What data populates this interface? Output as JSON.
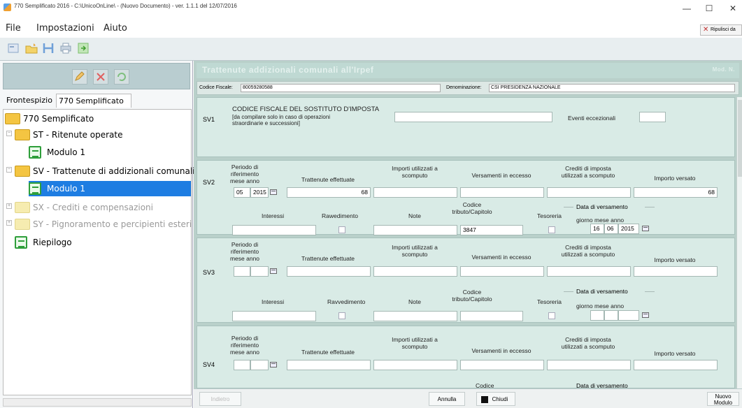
{
  "window": {
    "title": "770 Semplificato 2016 - C:\\UnicoOnLine\\ - (Nuovo Documento) - ver. 1.1.1 del 12/07/2016",
    "minimize": "—",
    "maximize": "☐",
    "close": "✕"
  },
  "menu": {
    "file": "File",
    "impostazioni": "Impostazioni",
    "aiuto": "Aiuto",
    "ripulisci": "Ripulisci da"
  },
  "tabs": {
    "frontespizio": "Frontespizio",
    "semplificato": "770 Semplificato"
  },
  "tree": {
    "root": "770 Semplificato",
    "st": "ST - Ritenute operate",
    "st_mod": "Modulo 1",
    "sv": "SV - Trattenute di addizionali comunali",
    "sv_mod": "Modulo 1",
    "sx": "SX - Crediti e compensazioni",
    "sy": "SY - Pignoramento e percipienti esteri",
    "riepilogo": "Riepilogo"
  },
  "main": {
    "title": "Trattenute addizionali comunali all'Irpef",
    "mod_nav": "Mod. N.",
    "codice_fiscale_label": "Codice Fiscale:",
    "codice_fiscale": "80059280588",
    "denominazione_label": "Denominazione:",
    "denominazione": "CSI PRESIDENZA NAZIONALE"
  },
  "sv1": {
    "code": "SV1",
    "title": "CODICE FISCALE DEL SOSTITUTO D'IMPOSTA",
    "subtitle1": "[da compilare solo in caso di operazioni",
    "subtitle2": "straordinarie e successioni]",
    "eventi": "Eventi eccezionali"
  },
  "headers": {
    "periodo": [
      "Periodo di",
      "riferimento",
      "mese anno"
    ],
    "trattenute": "Trattenute effettuate",
    "importi": [
      "Importi utilizzati a",
      "scomputo"
    ],
    "versamenti": "Versamenti in eccesso",
    "crediti": [
      "Crediti di imposta",
      "utilizzati a scomputo"
    ],
    "importo_versato": "Importo versato",
    "interessi": "Interessi",
    "ravvedimento": "Rawedimento",
    "note": "Note",
    "codice": [
      "Codice",
      "tributo/Capitolo"
    ],
    "tesoreria": "Tesoreria",
    "data_versamento": "Data di versamento",
    "giorno_mese_anno": "giorno mese anno"
  },
  "sv2": {
    "code": "SV2",
    "mese": "05",
    "anno": "2015",
    "trattenute": "68",
    "importo_versato": "68",
    "codice_tributo": "3847",
    "giorno": "16",
    "mese_v": "06",
    "anno_v": "2015"
  },
  "sv3": {
    "code": "SV3",
    "ravvedimento": "Ravvedimento"
  },
  "sv4": {
    "code": "SV4",
    "codice_partial": "Codice",
    "data_partial": "Data di versamento"
  },
  "bottom": {
    "indietro": "Indietro",
    "annulla": "Annulla",
    "chiudi": "Chiudi",
    "nuovo": "Nuovo\nModulo"
  }
}
